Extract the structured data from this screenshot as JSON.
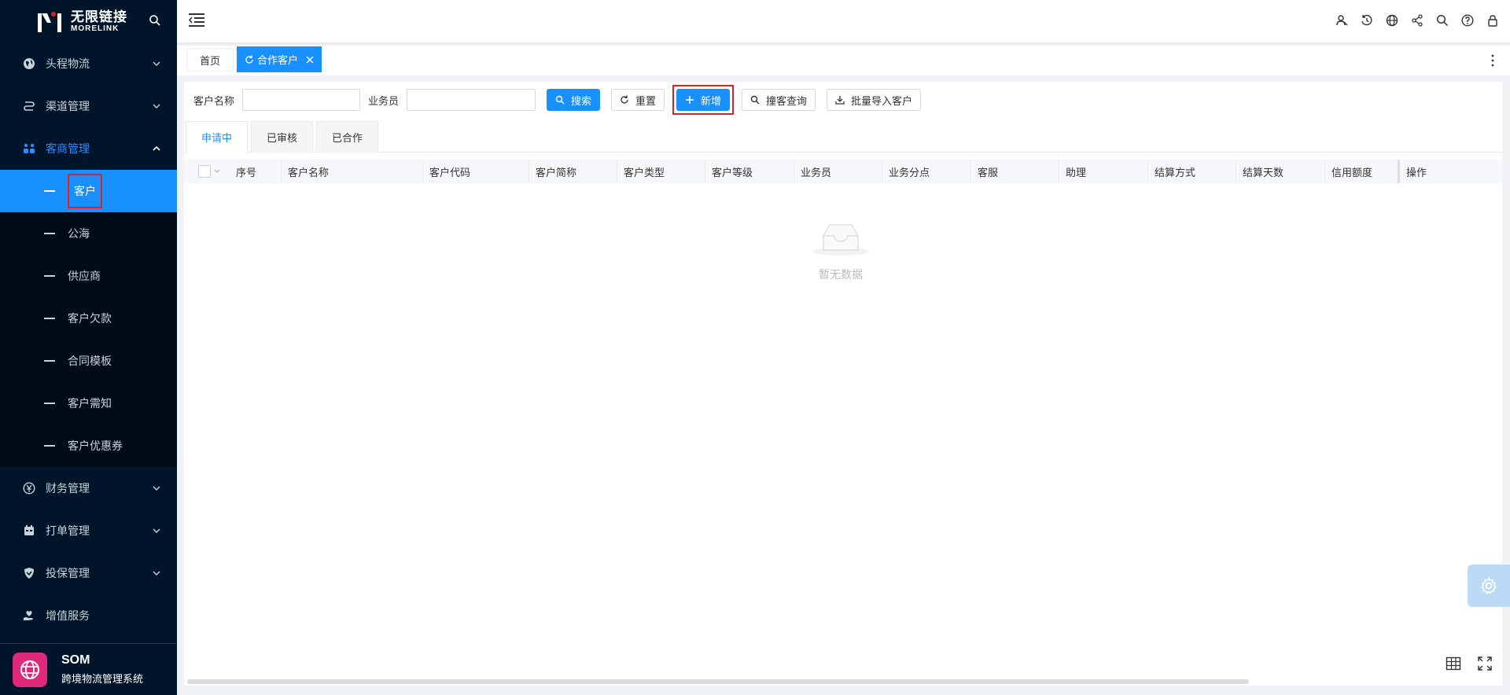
{
  "brand": {
    "cn": "无限链接",
    "en": "MORELINK"
  },
  "sidebar": {
    "items": [
      {
        "label": "头程物流",
        "icon": "globe-icon"
      },
      {
        "label": "渠道管理",
        "icon": "route-icon"
      },
      {
        "label": "客商管理",
        "icon": "people-icon"
      },
      {
        "label": "财务管理",
        "icon": "yen-icon"
      },
      {
        "label": "打单管理",
        "icon": "calendar-icon"
      },
      {
        "label": "投保管理",
        "icon": "shield-icon"
      },
      {
        "label": "增值服务",
        "icon": "hand-heart-icon"
      }
    ],
    "sub_items": [
      "客户",
      "公海",
      "供应商",
      "客户欠款",
      "合同模板",
      "客户需知",
      "客户优惠券"
    ]
  },
  "bottom_brand": {
    "title": "SOM",
    "subtitle": "跨境物流管理系统"
  },
  "tabs": {
    "home": "首页",
    "active": "合作客户"
  },
  "filter": {
    "customer_name_label": "客户名称",
    "salesperson_label": "业务员",
    "search": "搜索",
    "reset": "重置",
    "add": "新增",
    "collision_query": "撞客查询",
    "batch_import": "批量导入客户"
  },
  "subtabs": [
    "申请中",
    "已审核",
    "已合作"
  ],
  "table": {
    "columns": [
      "序号",
      "客户名称",
      "客户代码",
      "客户简称",
      "客户类型",
      "客户等级",
      "业务员",
      "业务分点",
      "客服",
      "助理",
      "结算方式",
      "结算天数",
      "信用额度",
      "操作"
    ]
  },
  "empty_text": "暂无数据",
  "colors": {
    "primary": "#1890ff",
    "sidebar": "#001529",
    "highlight": "#e02020"
  }
}
